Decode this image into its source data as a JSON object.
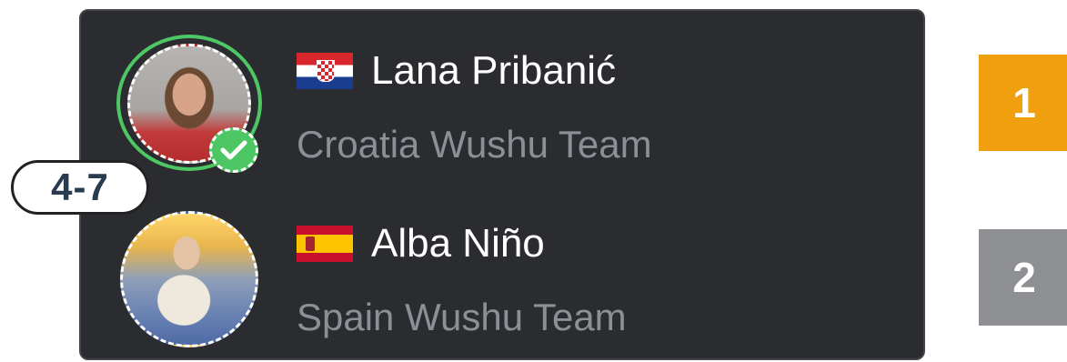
{
  "match": {
    "score": "4-7",
    "winner_badge_icon": "check-icon",
    "participants": [
      {
        "name": "Lana Pribanić",
        "team": "Croatia Wushu Team",
        "flag_icon": "croatia-flag-icon",
        "rank": "1",
        "rank_color": "#f0a00e",
        "winner": true
      },
      {
        "name": "Alba Niño",
        "team": "Spain Wushu Team",
        "flag_icon": "spain-flag-icon",
        "rank": "2",
        "rank_color": "#8e8f92",
        "winner": false
      }
    ]
  },
  "colors": {
    "card_bg": "#2b2c30",
    "winner_green": "#4cc764",
    "team_text": "#8d8f96"
  }
}
